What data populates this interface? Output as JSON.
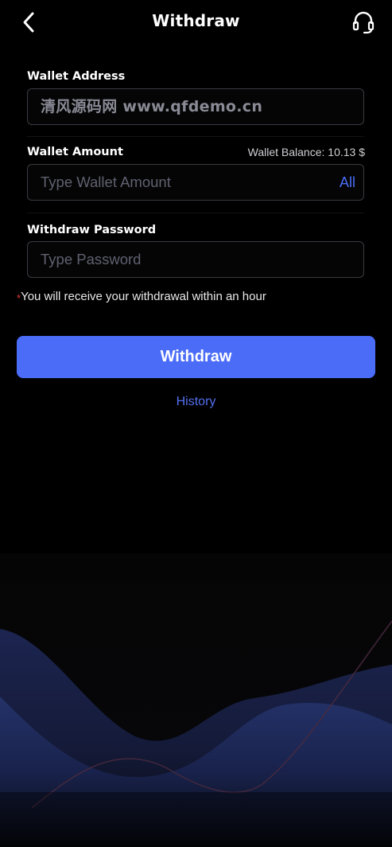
{
  "header": {
    "title": "Withdraw",
    "back_icon": "chevron-left-icon",
    "support_icon": "headset-icon"
  },
  "form": {
    "wallet_address": {
      "label": "Wallet Address",
      "value": "清风源码网 www.qfdemo.cn"
    },
    "wallet_amount": {
      "label": "Wallet Amount",
      "balance_text": "Wallet Balance: 10.13 $",
      "placeholder": "Type Wallet Amount",
      "all_label": "All"
    },
    "withdraw_password": {
      "label": "Withdraw Password",
      "placeholder": "Type Password"
    },
    "notice_star": "*",
    "notice": "You will receive your withdrawal within an hour"
  },
  "actions": {
    "withdraw_label": "Withdraw",
    "history_label": "History"
  },
  "colors": {
    "accent": "#4a6cf7",
    "background": "#000000",
    "required_star": "#e53b3b"
  }
}
